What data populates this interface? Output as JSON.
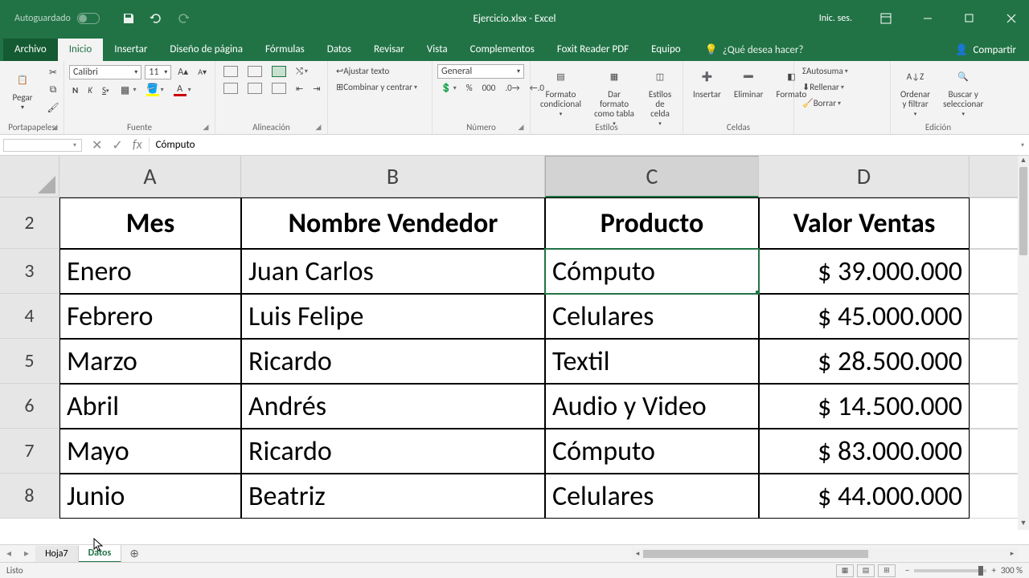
{
  "titlebar": {
    "autosave": "Autoguardado",
    "filename": "Ejercicio.xlsx - Excel",
    "signin": "Inic. ses."
  },
  "tabs": {
    "file": "Archivo",
    "home": "Inicio",
    "insert": "Insertar",
    "layout": "Diseño de página",
    "formulas": "Fórmulas",
    "data": "Datos",
    "review": "Revisar",
    "view": "Vista",
    "addins": "Complementos",
    "foxit": "Foxit Reader PDF",
    "team": "Equipo",
    "tellme": "¿Qué desea hacer?",
    "share": "Compartir"
  },
  "ribbon": {
    "clipboard": {
      "paste": "Pegar",
      "label": "Portapapeles"
    },
    "font": {
      "name": "Calibri",
      "size": "11",
      "label": "Fuente"
    },
    "align": {
      "wrap": "Ajustar texto",
      "merge": "Combinar y centrar",
      "label": "Alineación"
    },
    "number": {
      "format": "General",
      "label": "Número"
    },
    "styles": {
      "cond": "Formato condicional",
      "table": "Dar formato como tabla",
      "cell": "Estilos de celda",
      "label": "Estilos"
    },
    "cells": {
      "insert": "Insertar",
      "delete": "Eliminar",
      "format": "Formato",
      "label": "Celdas"
    },
    "editing": {
      "sum": "Autosuma",
      "fill": "Rellenar",
      "clear": "Borrar",
      "sort": "Ordenar y filtrar",
      "find": "Buscar y seleccionar",
      "label": "Edición"
    }
  },
  "fxbar": {
    "namebox": "",
    "formula": "Cómputo"
  },
  "grid": {
    "cols": [
      "A",
      "B",
      "C",
      "D"
    ],
    "selected_col": "C",
    "row_start": 2,
    "headers": [
      "Mes",
      "Nombre Vendedor",
      "Producto",
      "Valor Ventas"
    ],
    "rows": [
      {
        "n": 3,
        "mes": "Enero",
        "vend": "Juan Carlos",
        "prod": "Cómputo",
        "val": "$ 39.000.000"
      },
      {
        "n": 4,
        "mes": "Febrero",
        "vend": "Luis Felipe",
        "prod": "Celulares",
        "val": "$ 45.000.000"
      },
      {
        "n": 5,
        "mes": "Marzo",
        "vend": "Ricardo",
        "prod": "Textil",
        "val": "$ 28.500.000"
      },
      {
        "n": 6,
        "mes": "Abril",
        "vend": "Andrés",
        "prod": "Audio y Video",
        "val": "$ 14.500.000"
      },
      {
        "n": 7,
        "mes": "Mayo",
        "vend": "Ricardo",
        "prod": "Cómputo",
        "val": "$ 83.000.000"
      },
      {
        "n": 8,
        "mes": "Junio",
        "vend": "Beatriz",
        "prod": "Celulares",
        "val": "$ 44.000.000"
      }
    ],
    "selected_cell": {
      "row": 3,
      "col": "C"
    }
  },
  "sheets": {
    "tab1": "Hoja7",
    "tab2": "Datos"
  },
  "status": {
    "ready": "Listo",
    "zoom": "300 %"
  }
}
